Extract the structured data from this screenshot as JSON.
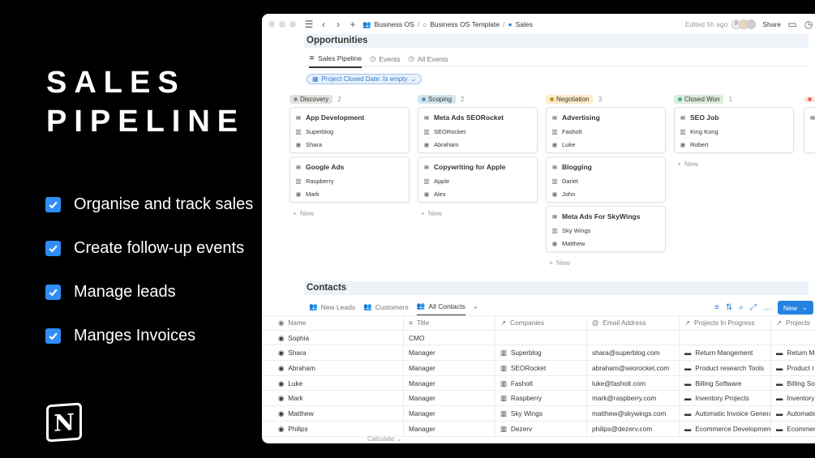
{
  "promo": {
    "title_line1": "SALES",
    "title_line2": "PIPELINE",
    "features": [
      "Organise and track sales",
      "Create follow-up events",
      "Manage leads",
      "Manges Invoices"
    ],
    "logo_letter": "N"
  },
  "window": {
    "breadcrumbs": [
      "Business OS",
      "Business OS Template",
      "Sales"
    ],
    "edited": "Edited 5h ago",
    "share": "Share",
    "avatar_initial": "P"
  },
  "opportunities": {
    "title": "Opportunities",
    "tabs": [
      "Sales Pipeline",
      "Events",
      "All Events"
    ],
    "filter": "Project Closed Date: Is empty",
    "new_label": "New",
    "columns": [
      {
        "name": "Discovery",
        "count": "2",
        "bg": "#e3e2e0",
        "dot": "#91918e",
        "cards": [
          {
            "title": "App Development",
            "company": "Superblog",
            "person": "Shara"
          },
          {
            "title": "Google Ads",
            "company": "Raspberry",
            "person": "Mark"
          }
        ]
      },
      {
        "name": "Scoping",
        "count": "2",
        "bg": "#d3e5ef",
        "dot": "#5b97bd",
        "cards": [
          {
            "title": "Meta Ads SEORocket",
            "company": "SEORocket",
            "person": "Abraham"
          },
          {
            "title": "Copywriting for Apple",
            "company": "Apple",
            "person": "Alex"
          }
        ]
      },
      {
        "name": "Negotiation",
        "count": "3",
        "bg": "#fdecc8",
        "dot": "#cb912f",
        "cards": [
          {
            "title": "Advertising",
            "company": "Fasholt",
            "person": "Luke"
          },
          {
            "title": "Blogging",
            "company": "Dariet",
            "person": "John"
          },
          {
            "title": "Meta Ads For SkyWings",
            "company": "Sky Wings",
            "person": "Matthew"
          }
        ]
      },
      {
        "name": "Closed Won",
        "count": "1",
        "bg": "#dbeddb",
        "dot": "#4dab9a",
        "cards": [
          {
            "title": "SEO Job",
            "company": "King Kong",
            "person": "Robert"
          }
        ]
      }
    ]
  },
  "contacts": {
    "title": "Contacts",
    "tabs": [
      "New Leads",
      "Customers",
      "All Contacts"
    ],
    "new_button": "New",
    "columns": [
      "Name",
      "Title",
      "Companies",
      "Email Address",
      "Projects In Progress",
      "Projects"
    ],
    "rows": [
      {
        "name": "Sophia",
        "title": "CMO",
        "company": "",
        "email": "",
        "proj": "",
        "proj2": ""
      },
      {
        "name": "Shara",
        "title": "Manager",
        "company": "Superblog",
        "email": "shara@superblog.com",
        "proj": "Return Mangement",
        "proj2": "Return Ma"
      },
      {
        "name": "Abraham",
        "title": "Manager",
        "company": "SEORocket",
        "email": "abraham@seorocket.com",
        "proj": "Product research Tools",
        "proj2": "Product r"
      },
      {
        "name": "Luke",
        "title": "Manager",
        "company": "Fasholt",
        "email": "luke@fasholt.com",
        "proj": "Billing Software",
        "proj2": "Billing Sof"
      },
      {
        "name": "Mark",
        "title": "Manager",
        "company": "Raspberry",
        "email": "mark@raspberry.com",
        "proj": "Inventory Projects",
        "proj2": "Inventory"
      },
      {
        "name": "Matthew",
        "title": "Manager",
        "company": "Sky Wings",
        "email": "matthew@skywings.com",
        "proj": "Automatic Invoice Genera",
        "proj2": "Automatic"
      },
      {
        "name": "Philips",
        "title": "Manager",
        "company": "Dezerv",
        "email": "philips@dezerv.com",
        "proj": "Ecommerce Development",
        "proj2": "Ecommerc"
      }
    ],
    "calculate": "Calculate"
  }
}
